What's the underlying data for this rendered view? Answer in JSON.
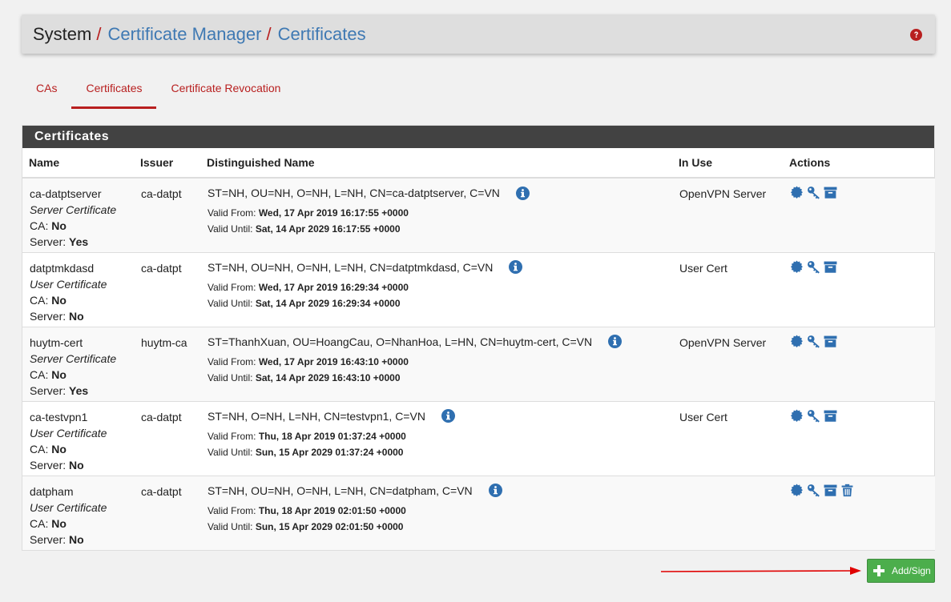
{
  "breadcrumb": {
    "root": "System",
    "sep": "/",
    "level1": "Certificate Manager",
    "level2": "Certificates"
  },
  "tabs": [
    {
      "label": "CAs",
      "active": false
    },
    {
      "label": "Certificates",
      "active": true
    },
    {
      "label": "Certificate Revocation",
      "active": false
    }
  ],
  "panel": {
    "title": "Certificates",
    "columns": [
      "Name",
      "Issuer",
      "Distinguished Name",
      "In Use",
      "Actions"
    ]
  },
  "labels": {
    "ca": "CA:",
    "server": "Server:",
    "valid_from": "Valid From:",
    "valid_until": "Valid Until:"
  },
  "rows": [
    {
      "name": "ca-datptserver",
      "type": "Server Certificate",
      "ca": "No",
      "server": "Yes",
      "issuer": "ca-datpt",
      "dn": "ST=NH, OU=NH, O=NH, L=NH, CN=ca-datptserver, C=VN",
      "valid_from": "Wed, 17 Apr 2019 16:17:55 +0000",
      "valid_until": "Sat, 14 Apr 2029 16:17:55 +0000",
      "in_use": "OpenVPN Server",
      "actions": [
        "export-cert",
        "export-key",
        "export-p12"
      ]
    },
    {
      "name": "datptmkdasd",
      "type": "User Certificate",
      "ca": "No",
      "server": "No",
      "issuer": "ca-datpt",
      "dn": "ST=NH, OU=NH, O=NH, L=NH, CN=datptmkdasd, C=VN",
      "valid_from": "Wed, 17 Apr 2019 16:29:34 +0000",
      "valid_until": "Sat, 14 Apr 2029 16:29:34 +0000",
      "in_use": "User Cert",
      "actions": [
        "export-cert",
        "export-key",
        "export-p12"
      ]
    },
    {
      "name": "huytm-cert",
      "type": "Server Certificate",
      "ca": "No",
      "server": "Yes",
      "issuer": "huytm-ca",
      "dn": "ST=ThanhXuan, OU=HoangCau, O=NhanHoa, L=HN, CN=huytm-cert, C=VN",
      "valid_from": "Wed, 17 Apr 2019 16:43:10 +0000",
      "valid_until": "Sat, 14 Apr 2029 16:43:10 +0000",
      "in_use": "OpenVPN Server",
      "actions": [
        "export-cert",
        "export-key",
        "export-p12"
      ]
    },
    {
      "name": "ca-testvpn1",
      "type": "User Certificate",
      "ca": "No",
      "server": "No",
      "issuer": "ca-datpt",
      "dn": "ST=NH, O=NH, L=NH, CN=testvpn1, C=VN",
      "valid_from": "Thu, 18 Apr 2019 01:37:24 +0000",
      "valid_until": "Sun, 15 Apr 2029 01:37:24 +0000",
      "in_use": "User Cert",
      "actions": [
        "export-cert",
        "export-key",
        "export-p12"
      ]
    },
    {
      "name": "datpham",
      "type": "User Certificate",
      "ca": "No",
      "server": "No",
      "issuer": "ca-datpt",
      "dn": "ST=NH, OU=NH, O=NH, L=NH, CN=datpham, C=VN",
      "valid_from": "Thu, 18 Apr 2019 02:01:50 +0000",
      "valid_until": "Sun, 15 Apr 2029 02:01:50 +0000",
      "in_use": "",
      "actions": [
        "export-cert",
        "export-key",
        "export-p12",
        "delete"
      ]
    }
  ],
  "add_button": {
    "label": "Add/Sign"
  },
  "colors": {
    "accent_red": "#b81f1f",
    "link_blue": "#3f79b3",
    "icon_blue": "#2f6fb0",
    "success_green": "#4cae4c",
    "panel_header": "#424242"
  },
  "icons": {
    "help": "question-circle-icon",
    "info": "info-circle-icon",
    "export-cert": "certificate-icon",
    "export-key": "key-icon",
    "export-p12": "archive-icon",
    "delete": "trash-icon",
    "add": "plus-icon"
  }
}
